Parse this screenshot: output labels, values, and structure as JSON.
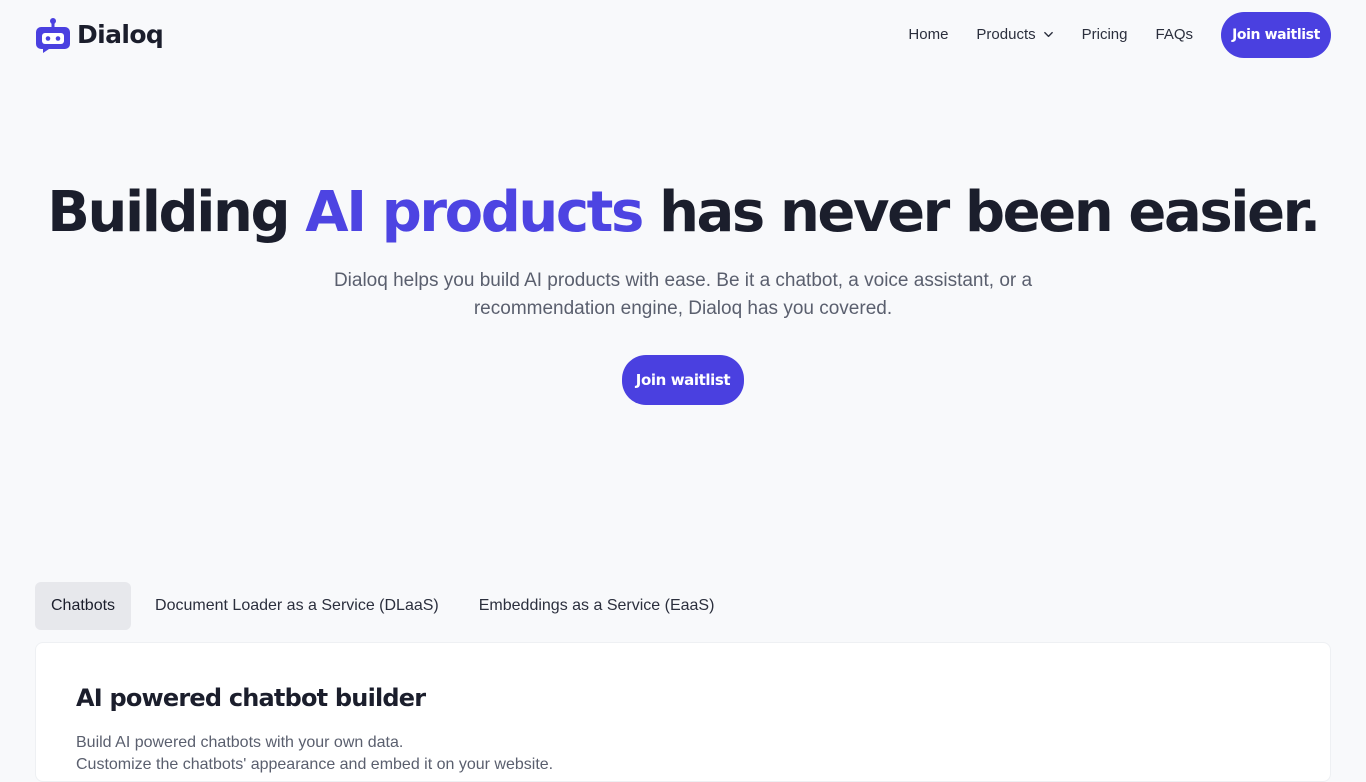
{
  "brand": {
    "name": "Dialoq",
    "icon": "robot-chat-icon",
    "color": "#4a40e0"
  },
  "nav": {
    "items": [
      {
        "label": "Home"
      },
      {
        "label": "Products",
        "icon": "chevron-down-icon"
      },
      {
        "label": "Pricing"
      },
      {
        "label": "FAQs"
      }
    ],
    "cta_label": "Join waitlist"
  },
  "hero": {
    "title_part1": "Building ",
    "title_accent": "AI products",
    "title_part2": " has never been easier.",
    "subtitle": "Dialoq helps you build AI products with ease. Be it a chatbot, a voice assistant, or a recommendation engine, Dialoq has you covered.",
    "cta_label": "Join waitlist",
    "accent_color": "#4d44e2"
  },
  "tabs": [
    {
      "label": "Chatbots",
      "active": true
    },
    {
      "label": "Document Loader as a Service (DLaaS)",
      "active": false
    },
    {
      "label": "Embeddings as a Service (EaaS)",
      "active": false
    }
  ],
  "feature_card": {
    "title": "AI powered chatbot builder",
    "lines": [
      "Build AI powered chatbots with your own data.",
      "Customize the chatbots' appearance and embed it on your website."
    ]
  }
}
